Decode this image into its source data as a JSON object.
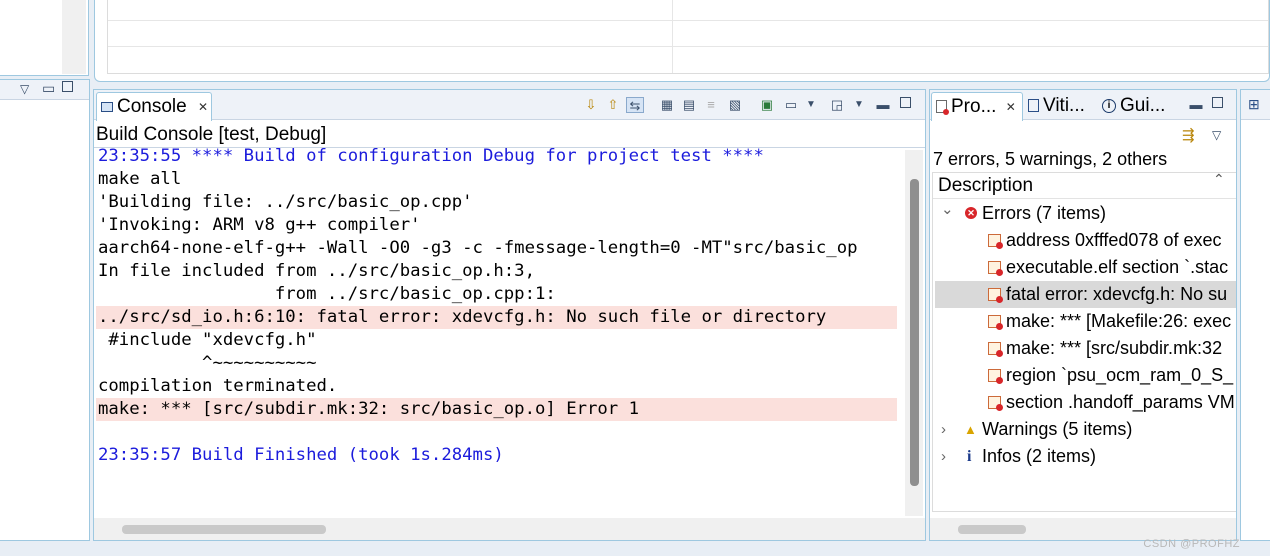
{
  "top_area": {},
  "left_panel": {
    "icons": [
      "view-menu-icon",
      "minimize-icon",
      "maximize-icon"
    ]
  },
  "console": {
    "tab_label": "Console",
    "tab_close": "✕",
    "build_console_title": "Build Console [test, Debug]",
    "lines": [
      {
        "text": "23:35:55 **** Build of configuration Debug for project test ****",
        "kind": "info"
      },
      {
        "text": "make all",
        "kind": "normal"
      },
      {
        "text": "'Building file: ../src/basic_op.cpp'",
        "kind": "normal"
      },
      {
        "text": "'Invoking: ARM v8 g++ compiler'",
        "kind": "normal"
      },
      {
        "text": "aarch64-none-elf-g++ -Wall -O0 -g3 -c -fmessage-length=0 -MT\"src/basic_op",
        "kind": "normal"
      },
      {
        "text": "In file included from ../src/basic_op.h:3,",
        "kind": "normal"
      },
      {
        "text": "                 from ../src/basic_op.cpp:1:",
        "kind": "normal"
      },
      {
        "text": "../src/sd_io.h:6:10: fatal error: xdevcfg.h: No such file or directory",
        "kind": "error"
      },
      {
        "text": " #include \"xdevcfg.h\"",
        "kind": "normal"
      },
      {
        "text": "          ^~~~~~~~~~~",
        "kind": "normal"
      },
      {
        "text": "compilation terminated.",
        "kind": "normal"
      },
      {
        "text": "make: *** [src/subdir.mk:32: src/basic_op.o] Error 1",
        "kind": "error"
      },
      {
        "text": "",
        "kind": "normal"
      },
      {
        "text": "23:35:57 Build Finished (took 1s.284ms)",
        "kind": "info"
      }
    ],
    "toolbar_icons": [
      "scroll-lock-down-icon",
      "scroll-lock-up-icon",
      "link-icon",
      "pin-icon",
      "word-wrap-icon",
      "remove-launch-icon",
      "clear-console-icon",
      "open-console-icon",
      "display-console-icon",
      "new-console-icon",
      "minimize-icon",
      "maximize-icon"
    ]
  },
  "problems": {
    "tabs": [
      {
        "label": "Pro...",
        "icon": "problems-icon"
      },
      {
        "label": "Viti...",
        "icon": "vitis-log-icon"
      },
      {
        "label": "Gui...",
        "icon": "guidance-icon"
      }
    ],
    "tab_close": "✕",
    "summary": "7 errors, 5 warnings, 2 others",
    "column_header": "Description",
    "groups": [
      {
        "label": "Errors (7 items)",
        "expanded": true,
        "icon": "error-icon",
        "toggle": "⌄"
      },
      {
        "label": "Warnings (5 items)",
        "expanded": false,
        "icon": "warning-icon",
        "toggle": "›"
      },
      {
        "label": "Infos (2 items)",
        "expanded": false,
        "icon": "info-icon",
        "toggle": "›"
      }
    ],
    "error_items": [
      {
        "text": "address 0xfffed078 of exec",
        "selected": false
      },
      {
        "text": "executable.elf section `.stac",
        "selected": false
      },
      {
        "text": "fatal error: xdevcfg.h: No su",
        "selected": true
      },
      {
        "text": "make: *** [Makefile:26: exec",
        "selected": false
      },
      {
        "text": "make: *** [src/subdir.mk:32",
        "selected": false
      },
      {
        "text": "region `psu_ocm_ram_0_S_",
        "selected": false
      },
      {
        "text": "section .handoff_params VM",
        "selected": false
      }
    ]
  },
  "watermark": "CSDN @PROFHZ",
  "colors": {
    "info_text": "#1c1cdc",
    "error_bg": "#fbe0dc",
    "selected_bg": "#d9d9d9",
    "border": "#9ec8e0",
    "background": "#e8eef5"
  }
}
